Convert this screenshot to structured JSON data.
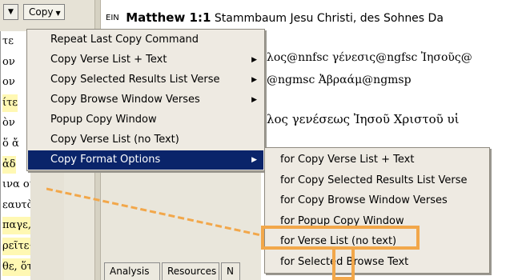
{
  "toolbar": {
    "dropdown_arrow": "▼",
    "copy_label": "Copy",
    "copy_arrow": "▼"
  },
  "left_greek": [
    {
      "text": "τε",
      "highlighted": false
    },
    {
      "text": "ον",
      "highlighted": false
    },
    {
      "text": "ον",
      "highlighted": false
    },
    {
      "text": "ίτε",
      "highlighted": true
    },
    {
      "text": "ὸν",
      "highlighted": false
    },
    {
      "text": "ὅ ἄ",
      "highlighted": false
    },
    {
      "text": "ἀδ",
      "highlighted": true
    },
    {
      "text": "ινα οἱ λ",
      "highlighted": false
    },
    {
      "text": "εαυτὸν",
      "highlighted": false
    },
    {
      "text": "παγε, σα",
      "highlighted": true
    },
    {
      "text": "ρεῖτε· ἤ",
      "highlighted": true
    },
    {
      "text": "θε, ὅτι",
      "highlighted": true
    }
  ],
  "text_pane": {
    "ein_label": "EIN",
    "reference": "Matthew 1:1",
    "verse_text": "Stammbaum Jesu Christi, des Sohnes Da",
    "tagged_line_1": "λος@nnfsc γένεσις@ngfsc Ἰησοῦς@",
    "tagged_line_2": "@ngmsc Ἀβραάμ@ngmsp",
    "greek_line": "λος γενέσεως Ἰησοῦ Χριστοῦ υἱ"
  },
  "tabs": [
    "Analysis",
    "Resources",
    "N"
  ],
  "copy_menu": {
    "items": [
      {
        "label": "Repeat Last Copy Command",
        "submenu": false,
        "selected": false
      },
      {
        "label": "Copy Verse List + Text",
        "submenu": true,
        "selected": false
      },
      {
        "label": "Copy Selected Results List Verse",
        "submenu": true,
        "selected": false
      },
      {
        "label": "Copy Browse Window Verses",
        "submenu": true,
        "selected": false
      },
      {
        "label": "Popup Copy Window",
        "submenu": false,
        "selected": false
      },
      {
        "label": "Copy Verse List (no Text)",
        "submenu": false,
        "selected": false
      },
      {
        "label": "Copy Format Options",
        "submenu": true,
        "selected": true
      }
    ],
    "submenu_arrow": "▶"
  },
  "format_submenu": {
    "items": [
      "for Copy Verse List + Text",
      "for Copy Selected Results List Verse",
      "for Copy Browse Window Verses",
      "for Popup Copy Window",
      "for Verse List (no text)",
      "for Selected Browse Text"
    ],
    "highlighted_item": "for Verse List (no text)"
  },
  "colors": {
    "menu_selected_bg": "#0a246a",
    "annotation_orange": "#f2a74a",
    "greek_highlight": "#fff8b3"
  }
}
